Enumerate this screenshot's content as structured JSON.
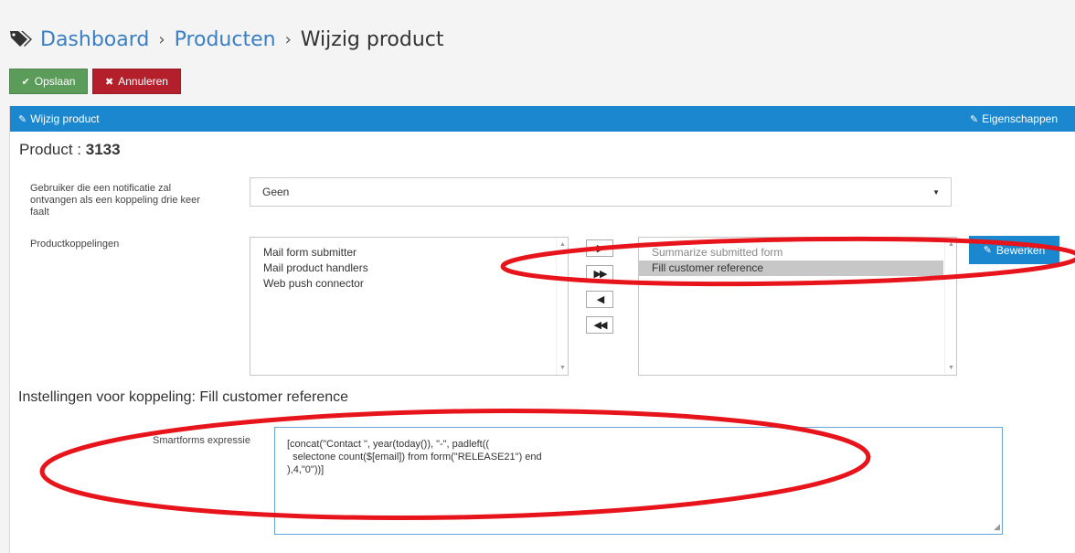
{
  "breadcrumb": {
    "items": [
      "Dashboard",
      "Producten",
      "Wijzig product"
    ],
    "separator": "›"
  },
  "toolbar": {
    "save_label": "Opslaan",
    "cancel_label": "Annuleren"
  },
  "panel": {
    "title": "Wijzig product",
    "properties_label": "Eigenschappen"
  },
  "product": {
    "label": "Product : ",
    "id": "3133"
  },
  "notification": {
    "label": "Gebruiker die een notificatie zal ontvangen als een koppeling drie keer faalt",
    "selected": "Geen"
  },
  "connections": {
    "label": "Productkoppelingen",
    "available": [
      "Mail form submitter",
      "Mail product handlers",
      "Web push connector"
    ],
    "selected": [
      "Summarize submitted form",
      "Fill customer reference"
    ],
    "edit_label": "Bewerken"
  },
  "settings": {
    "title": "Instellingen voor koppeling: Fill customer reference",
    "expression_label": "Smartforms expressie",
    "expression": "[concat(\"Contact \", year(today()), \"-\", padleft((\n  selectone count($[email]) from form(\"RELEASE21\") end\n),4,\"0\"))]"
  },
  "colors": {
    "primary": "#1a87cf",
    "save": "#5c9c5b",
    "cancel": "#b3202c",
    "annotation": "#e8141b"
  },
  "icons": [
    "tag-icon",
    "check-icon",
    "close-icon",
    "edit-icon"
  ]
}
